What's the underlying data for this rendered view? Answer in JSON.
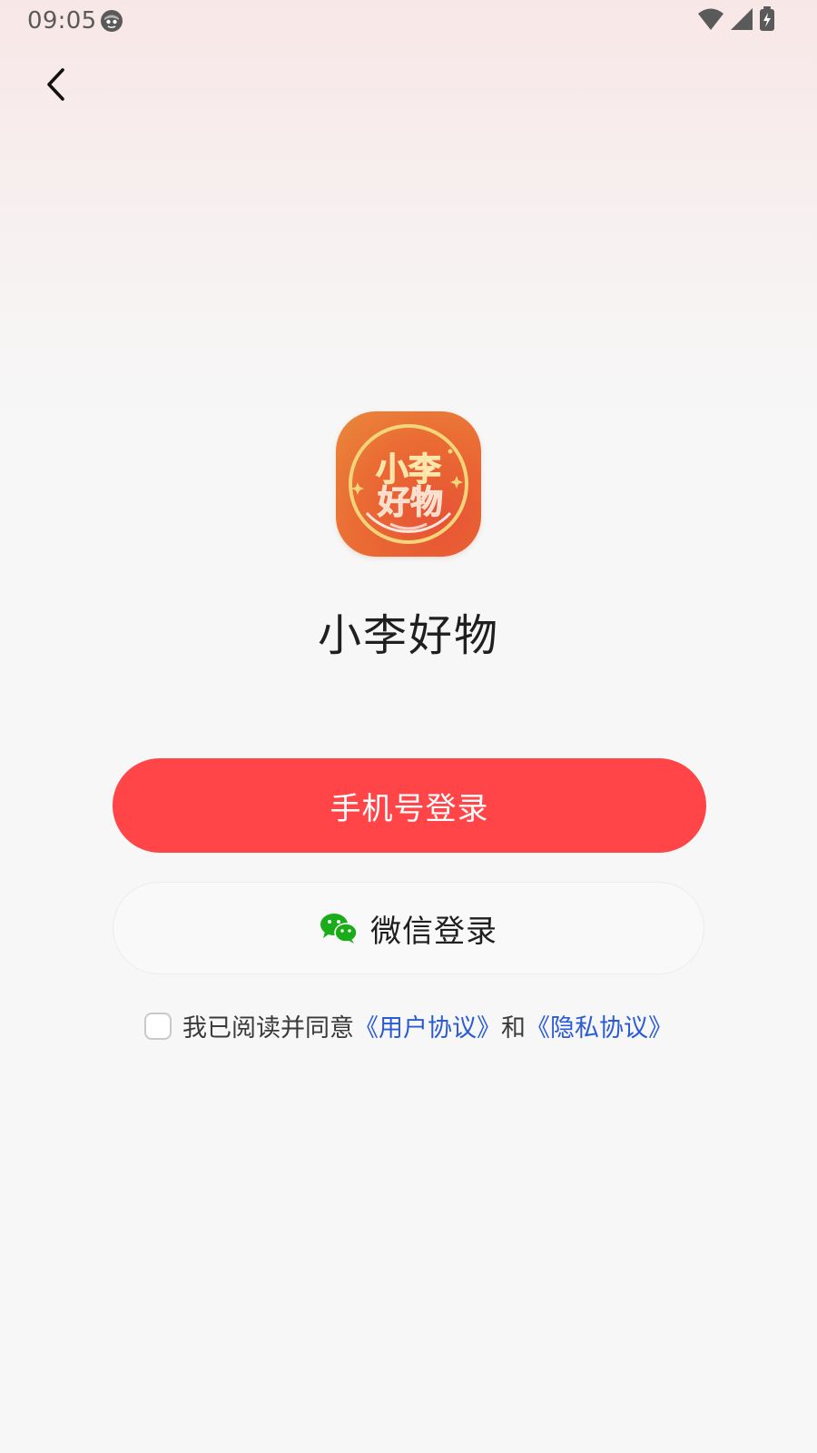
{
  "status_bar": {
    "time": "09:05",
    "icons": [
      "face-icon",
      "wifi-icon",
      "signal-icon",
      "battery-charging-icon"
    ]
  },
  "header": {
    "back_icon": "chevron-left-icon"
  },
  "app": {
    "logo_text_line1": "小李",
    "logo_text_line2": "好物",
    "name": "小李好物"
  },
  "buttons": {
    "phone_login": "手机号登录",
    "wechat_login": "微信登录",
    "wechat_icon": "wechat-icon"
  },
  "agreement": {
    "checked": false,
    "prefix": "我已阅读并同意",
    "user_agreement": "《用户协议》",
    "conjunction": "和",
    "privacy_agreement": "《隐私协议》"
  },
  "colors": {
    "primary": "#ff4548",
    "link": "#2a5bd7",
    "wechat_green": "#1aad19"
  }
}
